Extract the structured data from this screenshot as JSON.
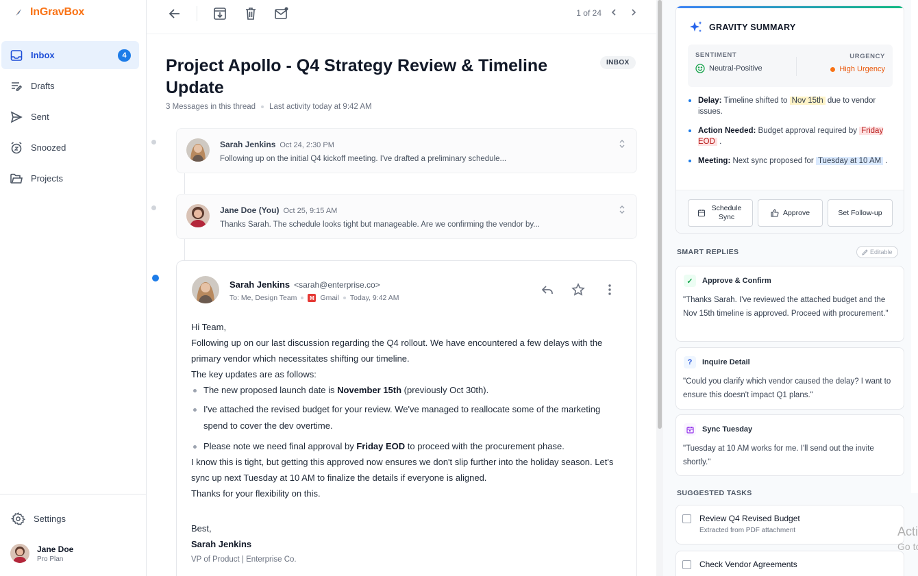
{
  "brand": {
    "name": "InGravBox"
  },
  "sidebar": {
    "items": [
      {
        "label": "Inbox",
        "badge": "4"
      },
      {
        "label": "Drafts"
      },
      {
        "label": "Sent"
      },
      {
        "label": "Snoozed"
      },
      {
        "label": "Projects"
      }
    ],
    "settings_label": "Settings",
    "user": {
      "name": "Jane Doe",
      "plan": "Pro Plan"
    }
  },
  "toolbar": {
    "pager": "1 of 24"
  },
  "thread": {
    "subject": "Project Apollo - Q4 Strategy Review & Timeline Update",
    "folder_tag": "INBOX",
    "message_count": "3 Messages in this thread",
    "last_activity": "Last activity today at 9:42 AM",
    "collapsed": [
      {
        "from": "Sarah Jenkins",
        "date": "Oct 24, 2:30 PM",
        "snippet": "Following up on the initial Q4 kickoff meeting. I've drafted a preliminary schedule..."
      },
      {
        "from": "Jane Doe (You)",
        "date": "Oct 25, 9:15 AM",
        "snippet": "Thanks Sarah. The schedule looks tight but manageable. Are we confirming the vendor by..."
      }
    ],
    "open": {
      "from": "Sarah Jenkins",
      "email": "<sarah@enterprise.co>",
      "to": "To: Me, Design Team",
      "source": "Gmail",
      "time": "Today, 9:42 AM",
      "greeting": "Hi Team,",
      "p1": "Following up on our last discussion regarding the Q4 rollout. We have encountered a few delays with the primary vendor which necessitates shifting our timeline.",
      "p2": "The key updates are as follows:",
      "b1_pre": "The new proposed launch date is ",
      "b1_bold": "November 15th",
      "b1_post": " (previously Oct 30th).",
      "b2": "I've attached the revised budget for your review. We've managed to reallocate some of the marketing spend to cover the dev overtime.",
      "b3_pre": "Please note we need final approval by ",
      "b3_bold": "Friday EOD",
      "b3_post": " to proceed with the procurement phase.",
      "p3": "I know this is tight, but getting this approved now ensures we don't slip further into the holiday season. Let's sync up next Tuesday at 10 AM to finalize the details if everyone is aligned.",
      "p4": "Thanks for your flexibility on this.",
      "signoff": "Best,",
      "sig_name": "Sarah Jenkins",
      "sig_role": "VP of Product | Enterprise Co."
    }
  },
  "summary": {
    "title": "GRAVITY SUMMARY",
    "sentiment_label": "SENTIMENT",
    "sentiment_value": "Neutral-Positive",
    "urgency_label": "URGENCY",
    "urgency_value": "High Urgency",
    "delay_label": "Delay:",
    "delay_pre": "Timeline shifted to",
    "delay_hl": "Nov 15th",
    "delay_post": "due to vendor issues.",
    "action_label": "Action Needed:",
    "action_pre": "Budget approval required by",
    "action_hl": "Friday EOD",
    "action_post": ".",
    "meeting_label": "Meeting:",
    "meeting_pre": "Next sync proposed for",
    "meeting_hl": "Tuesday at 10 AM",
    "meeting_post": ".",
    "btn_schedule": "Schedule Sync",
    "btn_approve": "Approve",
    "btn_followup": "Set Follow-up"
  },
  "smart_replies": {
    "heading": "SMART REPLIES",
    "editable": "Editable",
    "items": [
      {
        "title": "Approve & Confirm",
        "text": "\"Thanks Sarah. I've reviewed the attached budget and the Nov 15th timeline is approved. Proceed with procurement.\""
      },
      {
        "title": "Inquire Detail",
        "text": "\"Could you clarify which vendor caused the delay? I want to ensure this doesn't impact Q1 plans.\""
      },
      {
        "title": "Sync Tuesday",
        "text": "\"Tuesday at 10 AM works for me. I'll send out the invite shortly.\""
      }
    ]
  },
  "tasks": {
    "heading": "SUGGESTED TASKS",
    "items": [
      {
        "title": "Review Q4 Revised Budget",
        "sub": "Extracted from PDF attachment"
      },
      {
        "title": "Check Vendor Agreements"
      }
    ]
  },
  "watermark": {
    "line1": "Activate Windows",
    "line2": "Go to Settings to activate Windows."
  },
  "colors": {
    "accent": "#1d7ce8",
    "brand": "#f97316",
    "urgency": "#f97316"
  }
}
